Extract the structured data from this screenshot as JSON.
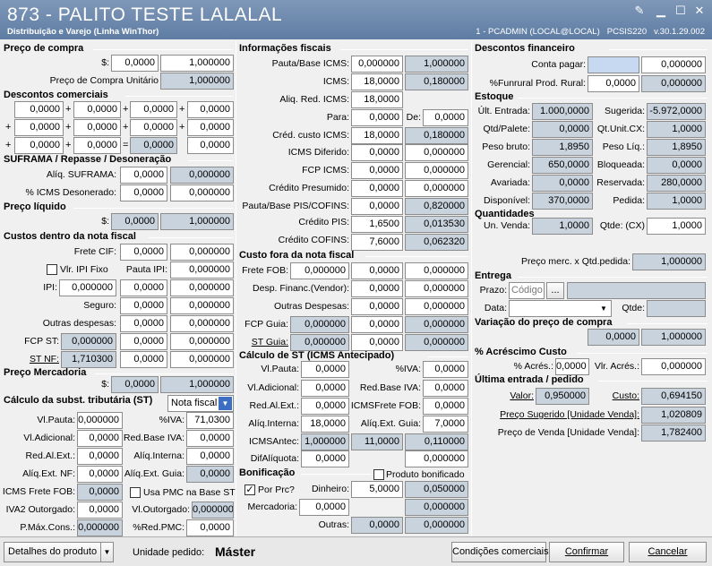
{
  "window": {
    "title": "873 - PALITO TESTE LALALAL",
    "subtitle": "Distribuição e Varejo (Linha WinThor)",
    "connection": "1 - PCADMIN (LOCAL@LOCAL)",
    "program": "PCSIS220",
    "version": "v.30.1.29.002"
  },
  "preco_compra": {
    "title": "Preço de compra",
    "currency": "$:",
    "v1": "0,0000",
    "v2": "1,000000",
    "unit_label": "Preço de Compra Unitário",
    "unit_value": "1,000000"
  },
  "descontos": {
    "title": "Descontos comerciais",
    "r1": [
      "0,0000",
      "0,0000",
      "0,0000",
      "0,0000"
    ],
    "r2": [
      "0,0000",
      "0,0000",
      "0,0000",
      "0,0000"
    ],
    "r3": [
      "0,0000",
      "0,0000",
      "0,0000",
      "0,0000"
    ],
    "plus": "+",
    "eq": "="
  },
  "suframa": {
    "title": "SUFRAMA / Repasse / Desoneração",
    "aliq_label": "Alíq. SUFRAMA:",
    "aliq_v1": "0,0000",
    "aliq_v2": "0,000000",
    "icms_label": "% ICMS Desonerado:",
    "icms_v1": "0,0000",
    "icms_v2": "0,000000"
  },
  "preco_liquido": {
    "title": "Preço líquido",
    "currency": "$:",
    "v1": "0,0000",
    "v2": "1,000000"
  },
  "custos_dentro": {
    "title": "Custos dentro da nota fiscal",
    "frete_cif": "Frete CIF:",
    "frete_v1": "0,0000",
    "frete_v2": "0,000000",
    "ipi_fixo": "Vlr. IPI Fixo",
    "pauta_ipi": "Pauta IPI:",
    "pauta_v": "0,000000",
    "ipi": "IPI:",
    "ipi_v1": "0,000000",
    "ipi_v2": "0,0000",
    "ipi_v3": "0,000000",
    "seguro": "Seguro:",
    "seguro_v1": "0,0000",
    "seguro_v2": "0,000000",
    "outras": "Outras despesas:",
    "outras_v1": "0,0000",
    "outras_v2": "0,000000",
    "fcp_st": "FCP ST:",
    "fcp_v1": "0,000000",
    "fcp_v2": "0,0000",
    "fcp_v3": "0,000000",
    "st_nf": "ST NF:",
    "st_v1": "1,710300",
    "st_v2": "0,0000",
    "st_v3": "0,000000"
  },
  "preco_mercadoria": {
    "title": "Preço Mercadoria",
    "currency": "$:",
    "v1": "0,0000",
    "v2": "1,000000"
  },
  "calc_st_left": {
    "title": "Cálculo da subst. tributária (ST)",
    "select": "Nota fiscal",
    "vl_pauta": "Vl.Pauta:",
    "vl_pauta_v": "0,000000",
    "piva": "%IVA:",
    "piva_v": "71,0300",
    "vl_adic": "Vl.Adicional:",
    "vl_adic_v": "0,0000",
    "red_base_iva": "Red.Base IVA:",
    "red_base_iva_v": "0,0000",
    "red_al_ext": "Red.Al.Ext.:",
    "red_al_ext_v": "0,0000",
    "aliq_interna": "Alíq.Interna:",
    "aliq_interna_v": "0,0000",
    "aliq_ext_nf": "Alíq.Ext. NF:",
    "aliq_ext_nf_v": "0,0000",
    "aliq_ext_guia": "Alíq.Ext. Guia:",
    "aliq_ext_guia_v": "0,0000",
    "icms_frete_fob": "ICMS Frete FOB:",
    "icms_frete_fob_v": "0,0000",
    "usa_pmc": "Usa PMC na Base ST",
    "iva2": "IVA2 Outorgado:",
    "iva2_v": "0,0000",
    "vl_outorgado": "Vl.Outorgado:",
    "vl_outorgado_v": "0,000000",
    "pmax": "P.Máx.Cons.:",
    "pmax_v": "0,000000",
    "pred_pmc": "%Red.PMC:",
    "pred_pmc_v": "0,0000"
  },
  "info_fiscais": {
    "title": "Informações fiscais",
    "pauta_base": "Pauta/Base ICMS:",
    "pauta_base_v1": "0,000000",
    "pauta_base_v2": "1,000000",
    "icms": "ICMS:",
    "icms_v1": "18,0000",
    "icms_v2": "0,180000",
    "aliq_red": "Aliq. Red. ICMS:",
    "aliq_red_v": "18,0000",
    "para": "Para:",
    "para_v": "0,0000",
    "de": "De:",
    "de_v": "0,0000",
    "cred_custo": "Créd. custo ICMS:",
    "cred_v1": "18,0000",
    "cred_v2": "0,180000",
    "icms_dif": "ICMS Diferido:",
    "icms_dif_v1": "0,0000",
    "icms_dif_v2": "0,000000",
    "fcp_icms": "FCP ICMS:",
    "fcp_icms_v1": "0,0000",
    "fcp_icms_v2": "0,000000",
    "cred_pres": "Crédito Presumido:",
    "cred_pres_v1": "0,0000",
    "cred_pres_v2": "0,000000",
    "pauta_pis": "Pauta/Base PIS/COFINS:",
    "pauta_pis_v1": "0,0000",
    "pauta_pis_v2": "0,820000",
    "cred_pis": "Crédito PIS:",
    "cred_pis_v1": "1,6500",
    "cred_pis_v2": "0,013530",
    "cred_cofins": "Crédito COFINS:",
    "cred_cofins_v1": "7,6000",
    "cred_cofins_v2": "0,062320"
  },
  "custo_fora": {
    "title": "Custo fora da nota fiscal",
    "frete_fob": "Frete FOB:",
    "frete_fob_v1": "0,000000",
    "frete_fob_v2": "0,0000",
    "frete_fob_v3": "0,000000",
    "desp_fin": "Desp. Financ.(Vendor):",
    "desp_fin_v1": "0,0000",
    "desp_fin_v2": "0,000000",
    "outras": "Outras Despesas:",
    "outras_v1": "0,0000",
    "outras_v2": "0,000000",
    "fcp_guia": "FCP Guia:",
    "fcp_guia_v1": "0,000000",
    "fcp_guia_v2": "0,0000",
    "fcp_guia_v3": "0,000000",
    "st_guia": "ST Guia:",
    "st_guia_v1": "0,000000",
    "st_guia_v2": "0,0000",
    "st_guia_v3": "0,000000"
  },
  "calc_st_antecipado": {
    "title": "Cálculo de ST (ICMS Antecipado)",
    "vl_pauta": "Vl.Pauta:",
    "vl_pauta_v": "0,0000",
    "piva": "%IVA:",
    "piva_v": "0,0000",
    "vl_adic": "Vl.Adicional:",
    "vl_adic_v": "0,0000",
    "red_base_iva": "Red.Base IVA:",
    "red_base_iva_v": "0,0000",
    "red_al_ext": "Red.Al.Ext.:",
    "red_al_ext_v": "0,0000",
    "icms_frete_fob": "ICMSFrete FOB:",
    "icms_frete_fob_v": "0,0000",
    "aliq_interna": "Alíq.Interna:",
    "aliq_interna_v": "18,0000",
    "aliq_ext_guia": "Alíq.Ext. Guia:",
    "aliq_ext_guia_v": "7,0000",
    "icms_antec": "ICMSAntec:",
    "icms_antec_v1": "1,000000",
    "icms_antec_v2": "11,0000",
    "icms_antec_v3": "0,110000",
    "dif_aliq": "DifAlíquota:",
    "dif_aliq_v1": "0,0000",
    "dif_aliq_v2": "0,000000"
  },
  "bonificacao": {
    "title": "Bonificação",
    "produto_bonificado": "Produto bonificado",
    "por_prc": "Por Prc?",
    "dinheiro": "Dinheiro:",
    "dinheiro_v1": "5,0000",
    "dinheiro_v2": "0,050000",
    "mercadoria": "Mercadoria:",
    "mercadoria_v1": "0,0000",
    "mercadoria_v2": "0,000000",
    "outras": "Outras:",
    "outras_v1": "0,0000",
    "outras_v2": "0,000000"
  },
  "descontos_fin": {
    "title": "Descontos financeiro",
    "conta_pagar": "Conta pagar:",
    "conta_pagar_v2": "0,000000",
    "funrural": "%Funrural Prod. Rural:",
    "funrural_v1": "0,0000",
    "funrural_v2": "0,000000"
  },
  "estoque": {
    "title": "Estoque",
    "ult_entrada": "Últ. Entrada:",
    "ult_entrada_v": "1.000,0000",
    "sugerida": "Sugerida:",
    "sugerida_v": "-5.972,0000",
    "qtd_palete": "Qtd/Palete:",
    "qtd_palete_v": "0,0000",
    "qt_unit_cx": "Qt.Unit.CX:",
    "qt_unit_cx_v": "1,0000",
    "peso_bruto": "Peso bruto:",
    "peso_bruto_v": "1,8950",
    "peso_liq": "Peso Líq.:",
    "peso_liq_v": "1,8950",
    "gerencial": "Gerencial:",
    "gerencial_v": "650,0000",
    "bloqueada": "Bloqueada:",
    "bloqueada_v": "0,0000",
    "avariada": "Avariada:",
    "avariada_v": "0,0000",
    "reservada": "Reservada:",
    "reservada_v": "280,0000",
    "disponivel": "Disponível:",
    "disponivel_v": "370,0000",
    "pedida": "Pedida:",
    "pedida_v": "1,0000"
  },
  "quantidades": {
    "title": "Quantidades",
    "un_venda": "Un. Venda:",
    "un_venda_v": "1,0000",
    "qtde_cx": "Qtde: (CX)",
    "qtde_cx_v": "1,0000",
    "preco_merc": "Preço merc. x Qtd.pedida:",
    "preco_merc_v": "1,000000"
  },
  "entrega": {
    "title": "Entrega",
    "prazo": "Prazo:",
    "prazo_placeholder": "Código",
    "ellipsis": "...",
    "data": "Data:",
    "qtde": "Qtde:"
  },
  "variacao": {
    "title": "Variação do preço de compra",
    "v1": "0,0000",
    "v2": "1,000000"
  },
  "acrescimo": {
    "title": "% Acréscimo Custo",
    "acres": "% Acrés.:",
    "acres_v": "0,0000",
    "vlr_acres": "Vlr. Acrés.:",
    "vlr_acres_v": "0,000000"
  },
  "ultima_entrada": {
    "title": "Última entrada / pedido",
    "valor": "Valor:",
    "valor_v": "0,950000",
    "custo": "Custo:",
    "custo_v": "0,694150",
    "preco_sug": "Preço Sugerido [Unidade Venda]:",
    "preco_sug_v": "1,020809",
    "preco_venda": "Preço de Venda [Unidade Venda]:",
    "preco_venda_v": "1,782400"
  },
  "footer": {
    "detalhes": "Detalhes do produto",
    "unidade_label": "Unidade pedido:",
    "unidade_value": "Máster",
    "condicoes": "Condições comerciais",
    "confirmar": "Confirmar",
    "cancelar": "Cancelar"
  }
}
